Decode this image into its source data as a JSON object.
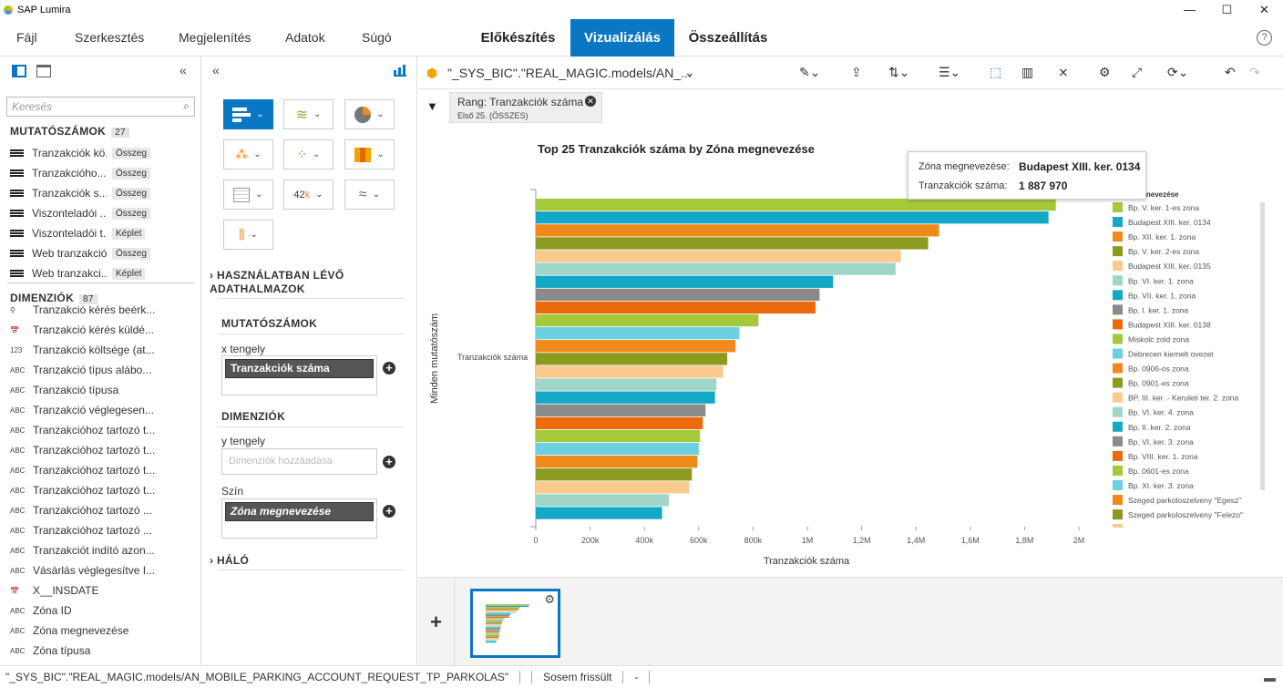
{
  "window": {
    "title": "SAP Lumira"
  },
  "menu": [
    "Fájl",
    "Szerkesztés",
    "Megjelenítés",
    "Adatok",
    "Súgó"
  ],
  "tabs": [
    "Előkészítés",
    "Vizualizálás",
    "Összeállítás"
  ],
  "search": {
    "placeholder": "Keresés"
  },
  "measures": {
    "title": "MUTATÓSZÁMOK",
    "count": "27",
    "items": [
      {
        "label": "Tranzakciók kö...",
        "badge": "Összeg"
      },
      {
        "label": "Tranzakcióho...",
        "badge": "Összeg"
      },
      {
        "label": "Tranzakciók s...",
        "badge": "Összeg"
      },
      {
        "label": "Viszonteladói ...",
        "badge": "Összeg"
      },
      {
        "label": "Viszonteladói t...",
        "badge": "Képlet"
      },
      {
        "label": "Web tranzakciók",
        "badge": "Összeg"
      },
      {
        "label": "Web tranzakci...",
        "badge": "Képlet"
      }
    ]
  },
  "dimensions": {
    "title": "DIMENZIÓK",
    "count": "87",
    "items": [
      {
        "type": "⚲",
        "label": "Tranzakció kérés beérk..."
      },
      {
        "type": "📅",
        "label": "Tranzakció kérés küldé..."
      },
      {
        "type": "123",
        "label": "Tranzakció költsége (at..."
      },
      {
        "type": "ABC",
        "label": "Tranzakció típus alábo..."
      },
      {
        "type": "ABC",
        "label": "Tranzakció típusa"
      },
      {
        "type": "ABC",
        "label": "Tranzakció véglegesen..."
      },
      {
        "type": "ABC",
        "label": "Tranzakcióhoz tartozó t..."
      },
      {
        "type": "ABC",
        "label": "Tranzakcióhoz tartozó t..."
      },
      {
        "type": "ABC",
        "label": "Tranzakcióhoz tartozó t..."
      },
      {
        "type": "ABC",
        "label": "Tranzakcióhoz tartozó t..."
      },
      {
        "type": "ABC",
        "label": "Tranzakcióhoz tartozó ..."
      },
      {
        "type": "ABC",
        "label": "Tranzakcióhoz tartozó ..."
      },
      {
        "type": "ABC",
        "label": "Tranzakciót indító azon..."
      },
      {
        "type": "ABC",
        "label": "Vásárlás véglegesítve I..."
      },
      {
        "type": "📅",
        "label": "X__INSDATE"
      },
      {
        "type": "ABC",
        "label": "Zóna ID"
      },
      {
        "type": "ABC",
        "label": "Zóna megnevezése"
      },
      {
        "type": "ABC",
        "label": "Zóna típusa"
      }
    ]
  },
  "builder": {
    "datasets": "HASZNÁLATBAN LÉVŐ\nADATHALMAZOK",
    "measures_title": "MUTATÓSZÁMOK",
    "x_label": "x tengely",
    "x_value": "Tranzakciók száma",
    "dimensions_title": "DIMENZIÓK",
    "y_label": "y tengely",
    "y_placeholder": "Dimenziók hozzáadása",
    "color_label": "Szín",
    "color_value": "Zóna megnevezése",
    "net": "HÁLÓ"
  },
  "toolbar": {
    "dataset": "\"_SYS_BIC\".\"REAL_MAGIC.models/AN_..."
  },
  "filter": {
    "title": "Rang: Tranzakciók száma",
    "sub": "Első 25. (ÖSSZES)"
  },
  "tooltip": {
    "k1": "Zóna megnevezése:",
    "v1": "Budapest XIII. ker. 0134",
    "k2": "Tranzakciók száma:",
    "v2": "1 887 970"
  },
  "status": {
    "source": "\"_SYS_BIC\".\"REAL_MAGIC.models/AN_MOBILE_PARKING_ACCOUNT_REQUEST_TP_PARKOLAS\"",
    "refresh": "Sosem frissült",
    "dash": "-"
  },
  "chart_data": {
    "type": "bar",
    "orientation": "horizontal",
    "title": "Top 25 Tranzakciók száma by Zóna megnevezése",
    "xlabel": "Tranzakciók száma",
    "ylabel": "Minden mutatószám",
    "category_label": "Tranzakciók száma",
    "xlim": [
      0,
      2000000
    ],
    "xticks": [
      "0",
      "200k",
      "400k",
      "600k",
      "800k",
      "1M",
      "1,2M",
      "1,4M",
      "1,6M",
      "1,8M",
      "2M"
    ],
    "legend_title": "gnevezése",
    "series": [
      {
        "name": "Bp. V. ker. 1-es zona",
        "value": 1915000,
        "color": "#a6c93c"
      },
      {
        "name": "Budapest XIII. ker. 0134",
        "value": 1887970,
        "color": "#13a8c5"
      },
      {
        "name": "Bp. XII. ker. 1. zona",
        "value": 1485000,
        "color": "#f0891b"
      },
      {
        "name": "Bp. V. ker. 2-es zona",
        "value": 1445000,
        "color": "#8c9a20"
      },
      {
        "name": "Budapest XIII. ker. 0135",
        "value": 1345000,
        "color": "#f9c98e"
      },
      {
        "name": "Bp. VI. ker. 1. zona",
        "value": 1325000,
        "color": "#9fd6c9"
      },
      {
        "name": "Bp. VII. ker. 1. zona",
        "value": 1095000,
        "color": "#13a8c5"
      },
      {
        "name": "Bp. I. ker. 1. zona",
        "value": 1045000,
        "color": "#8a8a8a"
      },
      {
        "name": "Budapest XIII. ker. 0138",
        "value": 1030000,
        "color": "#ea6a0c"
      },
      {
        "name": "Miskolc zold zona",
        "value": 820000,
        "color": "#a6c93c"
      },
      {
        "name": "Debrecen kiemelt ovezet",
        "value": 750000,
        "color": "#6dd0e0"
      },
      {
        "name": "Bp. 0906-os zona",
        "value": 735000,
        "color": "#f0891b"
      },
      {
        "name": "Bp. 0901-es zona",
        "value": 705000,
        "color": "#8c9a20"
      },
      {
        "name": "BP. III. ker. - Keruleti ter. 2. zona",
        "value": 690000,
        "color": "#f9c98e"
      },
      {
        "name": "Bp. VI. ker. 4. zona",
        "value": 665000,
        "color": "#9fd6c9"
      },
      {
        "name": "Bp. II. ker. 2. zona",
        "value": 660000,
        "color": "#13a8c5"
      },
      {
        "name": "Bp. VI. ker. 3. zona",
        "value": 625000,
        "color": "#8a8a8a"
      },
      {
        "name": "Bp. VIII. ker. 1. zona",
        "value": 615000,
        "color": "#ea6a0c"
      },
      {
        "name": "Bp. 0601-es zona",
        "value": 605000,
        "color": "#a6c93c"
      },
      {
        "name": "Bp. XI. ker. 3. zona",
        "value": 600000,
        "color": "#6dd0e0"
      },
      {
        "name": "Szeged parkoloszelveny \"Egesz\"",
        "value": 595000,
        "color": "#f0891b"
      },
      {
        "name": "Szeged parkoloszelveny \"Felezo\"",
        "value": 575000,
        "color": "#8c9a20"
      },
      {
        "name": "",
        "value": 565000,
        "color": "#f9c98e"
      },
      {
        "name": "",
        "value": 490000,
        "color": "#9fd6c9"
      },
      {
        "name": "",
        "value": 465000,
        "color": "#13a8c5"
      }
    ]
  }
}
